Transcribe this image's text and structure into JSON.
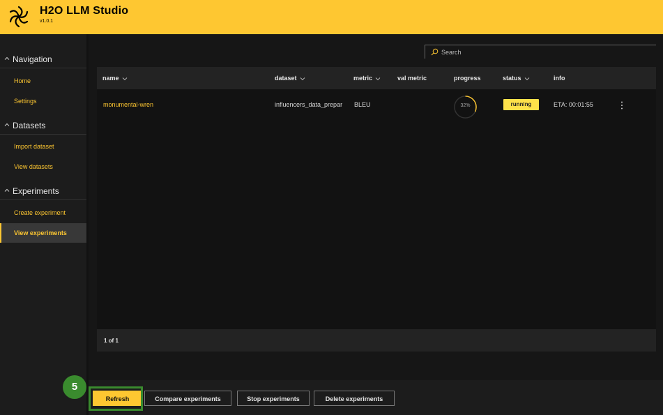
{
  "app": {
    "title": "H2O LLM Studio",
    "version": "v1.0.1",
    "accent": "#fec731"
  },
  "sidebar": {
    "groups": [
      {
        "label": "Navigation",
        "items": [
          {
            "label": "Home"
          },
          {
            "label": "Settings"
          }
        ]
      },
      {
        "label": "Datasets",
        "items": [
          {
            "label": "Import dataset"
          },
          {
            "label": "View datasets"
          }
        ]
      },
      {
        "label": "Experiments",
        "items": [
          {
            "label": "Create experiment"
          },
          {
            "label": "View experiments",
            "active": true
          }
        ]
      }
    ]
  },
  "search": {
    "placeholder": "Search"
  },
  "table": {
    "columns": [
      "name",
      "dataset",
      "metric",
      "val metric",
      "progress",
      "status",
      "info"
    ],
    "rows": [
      {
        "name": "monumental-wren",
        "dataset": "influencers_data_prepar",
        "metric": "BLEU",
        "val_metric": "",
        "progress": 0.32,
        "progress_label": "32%",
        "status": "running",
        "info": "ETA: 00:01:55"
      }
    ],
    "pager": "1 of 1"
  },
  "toolbar": {
    "refresh": "Refresh",
    "compare": "Compare experiments",
    "stop": "Stop experiments",
    "delete": "Delete experiments"
  },
  "annotation": {
    "step": "5",
    "color": "#3a8b2e"
  },
  "icons": [
    "h2o-logo-icon",
    "chevron-up-icon",
    "search-icon",
    "sort-chevron-icon",
    "more-vertical-icon"
  ]
}
